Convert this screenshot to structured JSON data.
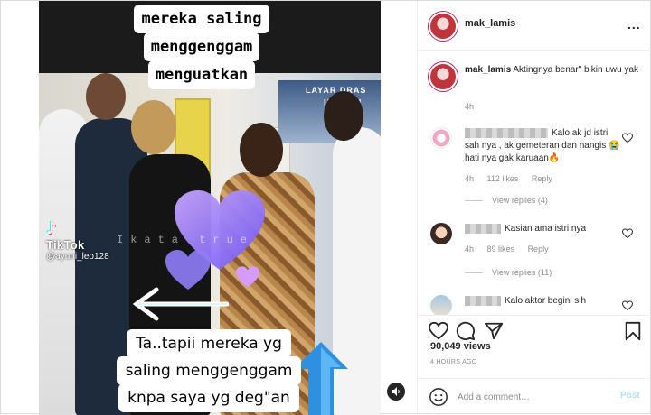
{
  "post": {
    "username": "mak_lamis",
    "more_label": "...",
    "caption_user": "mak_lamis",
    "caption_text": "Aktingnya benar\" bikin uwu yak",
    "caption_time": "4h"
  },
  "video": {
    "top_caption": [
      "mereka saling",
      "menggenggam",
      "menguatkan"
    ],
    "bottom_caption": [
      "Ta..tapii mereka yg",
      "saling menggenggam",
      "knpa saya yg deg\"an"
    ],
    "tiktok_label": "TikTok",
    "tiktok_user": "@ayuni_leo128",
    "watermark": "Ikata   true",
    "tv_label": "LAYAR DRAS",
    "tv_label2": "IKATAN"
  },
  "comments": [
    {
      "text": "Kalo ak jd istri sah nya , ak gemeteran dan nangis 😭hati nya gak karuaan🔥",
      "time": "4h",
      "likes": "112 likes",
      "reply": "Reply",
      "view_replies": "View replies (4)"
    },
    {
      "text": "Kasian ama istri nya",
      "time": "4h",
      "likes": "89 likes",
      "reply": "Reply",
      "view_replies": "View replies (11)"
    },
    {
      "text": "Kalo aktor begini sih"
    }
  ],
  "stats": {
    "views": "90,049 views",
    "ago": "4 HOURS AGO"
  },
  "composer": {
    "placeholder": "Add a comment…",
    "post_label": "Post"
  }
}
